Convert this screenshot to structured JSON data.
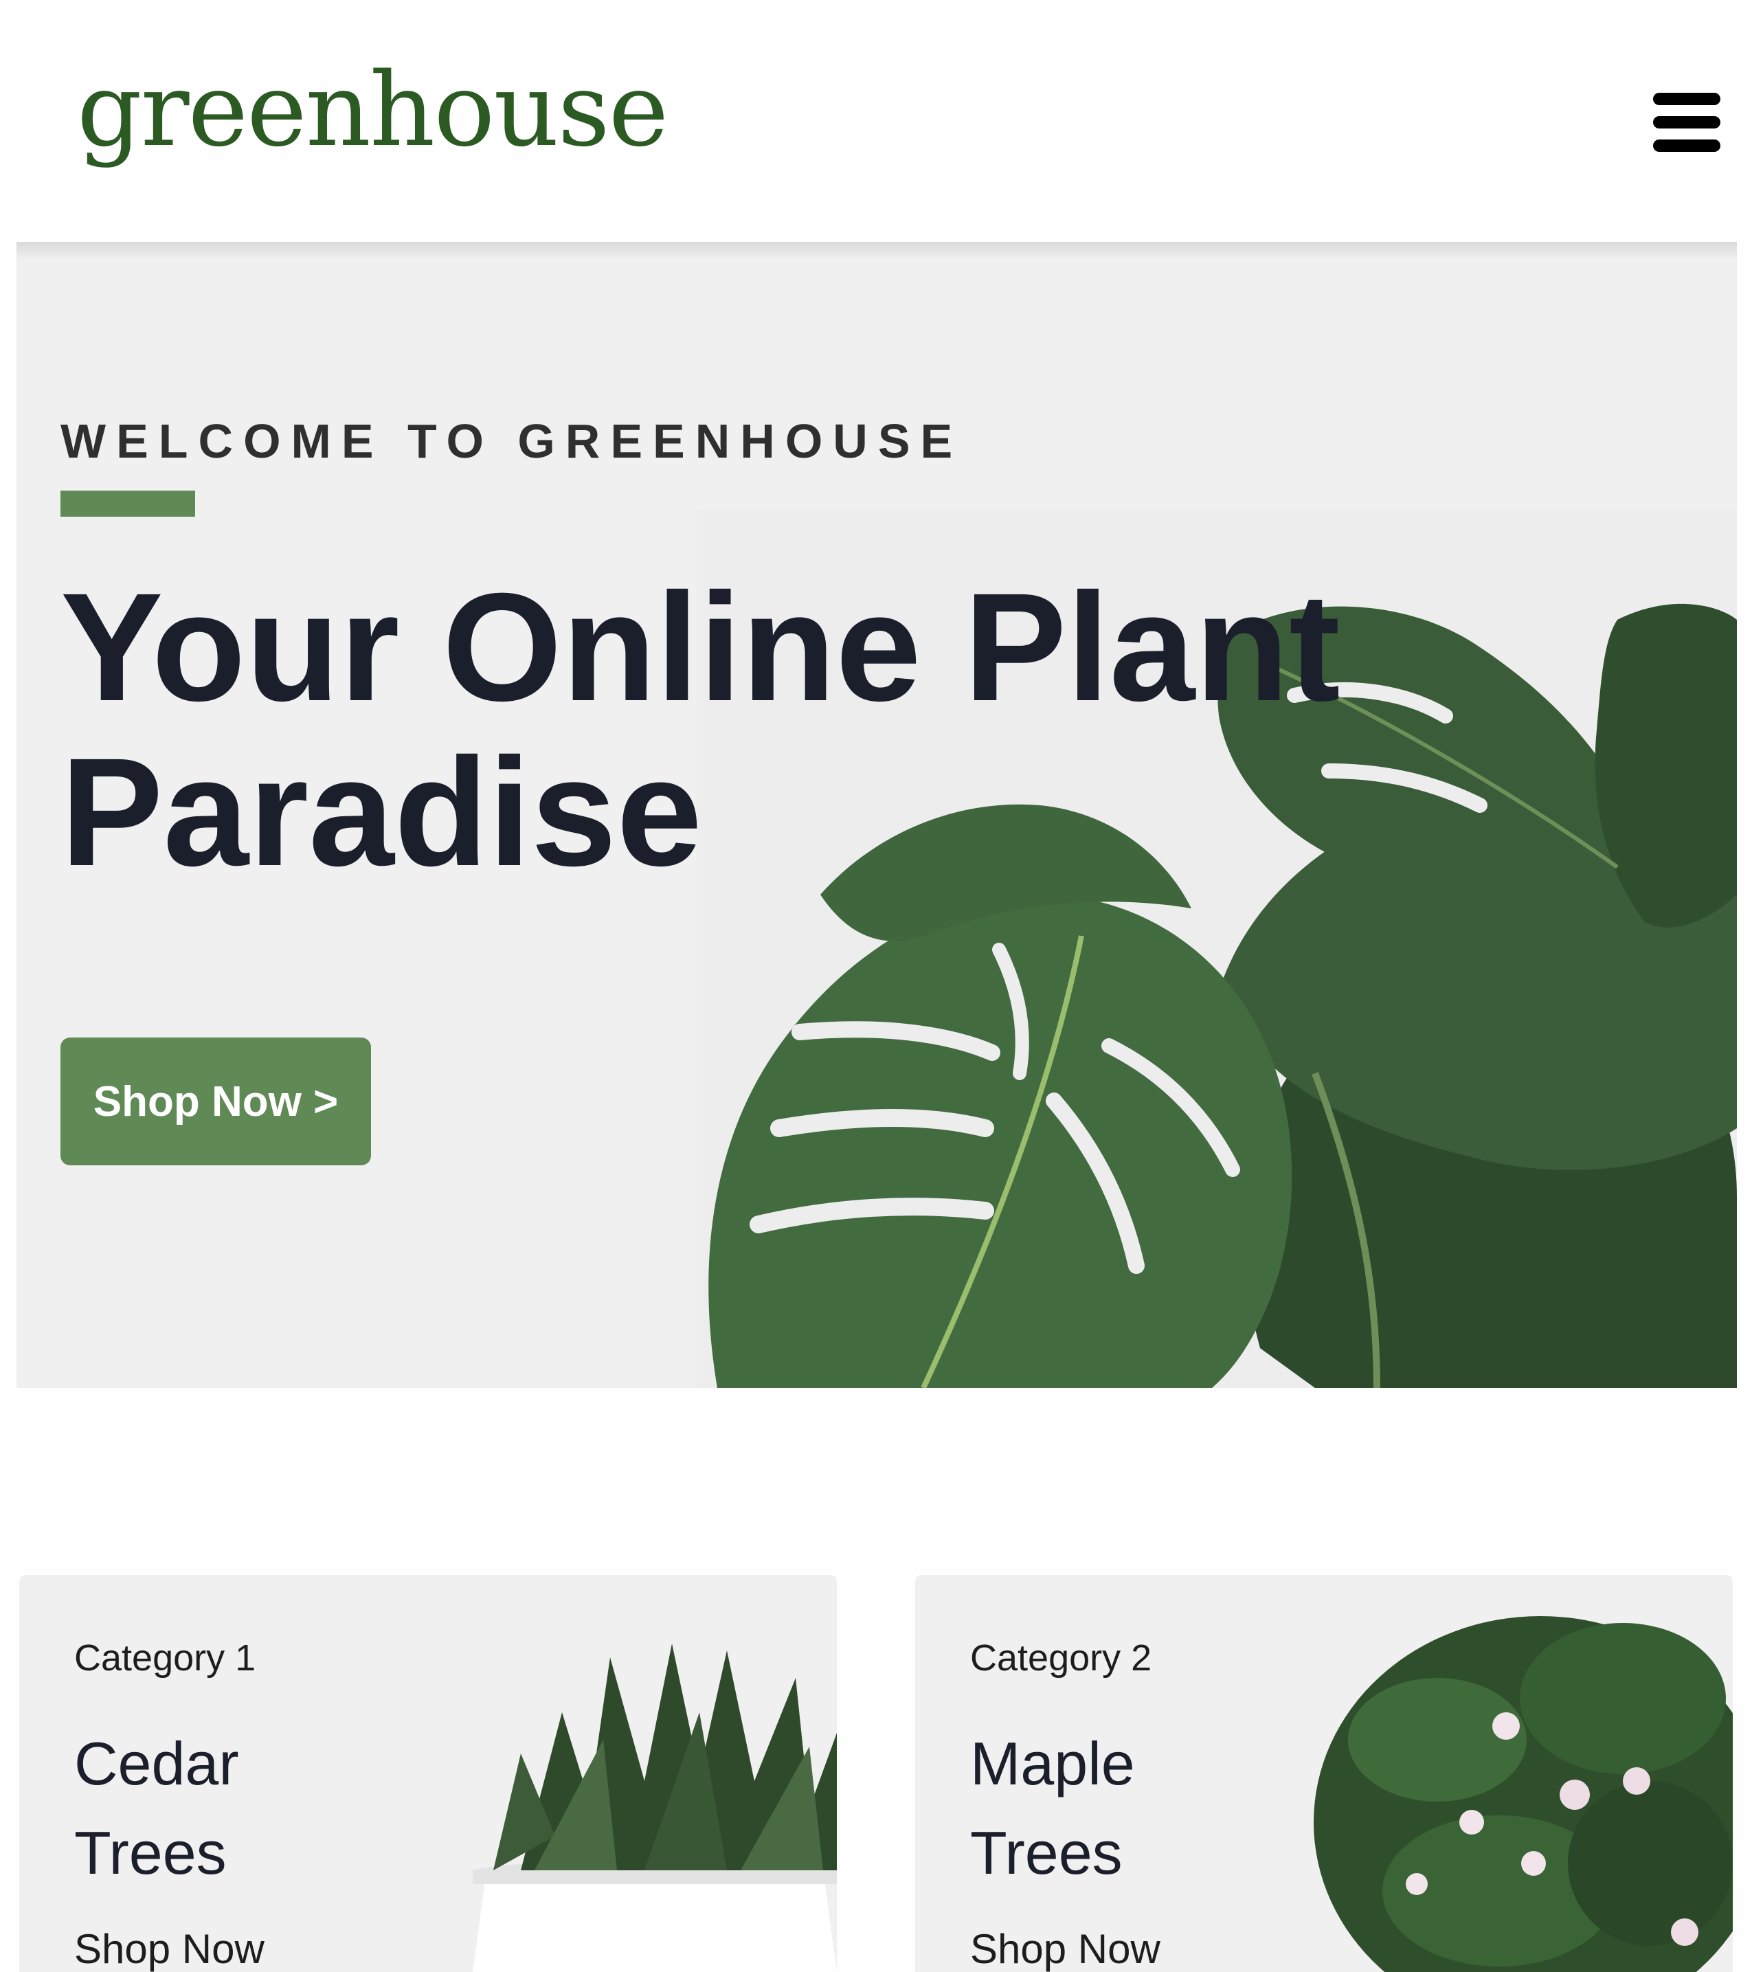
{
  "brand": {
    "logo_text": "greenhouse",
    "logo_icon": "leaf-icon",
    "color": "#2c5a23"
  },
  "nav": {
    "menu_icon": "hamburger-menu-icon"
  },
  "hero": {
    "eyebrow": "WELCOME TO GREENHOUSE",
    "title": "Your Online Plant\nParadise",
    "cta_label": "Shop Now >",
    "accent_color": "#5f8955",
    "image": "monstera-leaves"
  },
  "categories": [
    {
      "label": "Category 1",
      "title": "Cedar\nTrees",
      "link": "Shop Now",
      "image": "potted-succulent"
    },
    {
      "label": "Category 2",
      "title": "Maple\nTrees",
      "link": "Shop Now",
      "image": "flowering-shrub"
    }
  ]
}
